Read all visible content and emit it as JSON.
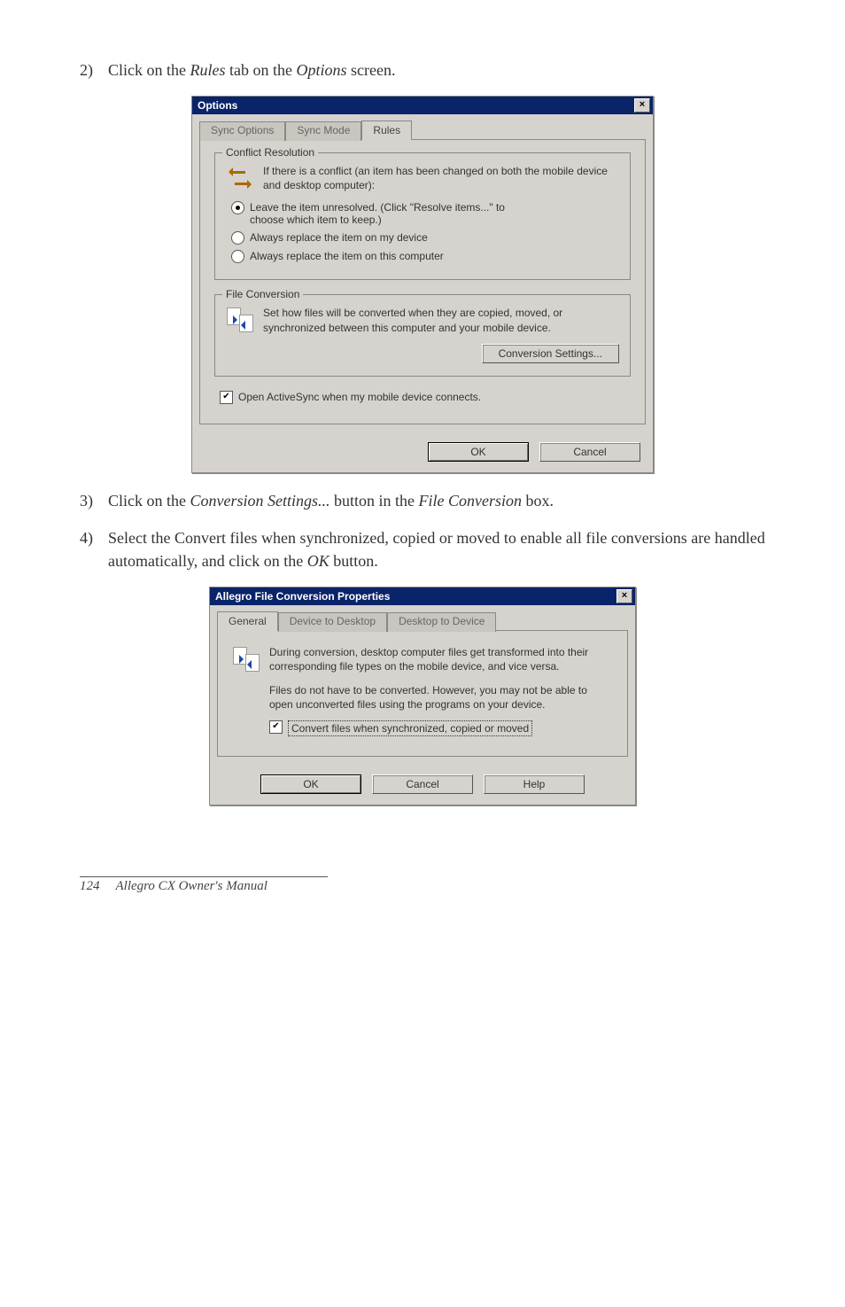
{
  "steps": {
    "s2": {
      "num": "2)",
      "text_a": "Click on the ",
      "em1": "Rules",
      "text_b": " tab on the ",
      "em2": "Options",
      "text_c": " screen."
    },
    "s3": {
      "num": "3)",
      "text_a": "Click on the ",
      "em1": "Conversion Settings...",
      "text_b": " button in the ",
      "em2": "File Conversion",
      "text_c": " box."
    },
    "s4": {
      "num": "4)",
      "text_a": "Select the Convert files when synchronized, copied or moved to enable all file conversions are handled automatically, and click on the ",
      "em1": "OK",
      "text_b": " button."
    }
  },
  "dialog1": {
    "title": "Options",
    "tabs": {
      "sync_options": "Sync Options",
      "sync_mode": "Sync Mode",
      "rules": "Rules"
    },
    "conflict": {
      "legend": "Conflict Resolution",
      "info": "If there is a conflict (an item has been changed on both the mobile device and desktop computer):",
      "r1a": "Leave the item unresolved. (Click \"Resolve items...\" to",
      "r1b": "choose which item to keep.)",
      "r2": "Always replace the item on my device",
      "r3": "Always replace the item on this computer"
    },
    "fileconv": {
      "legend": "File Conversion",
      "info": "Set how files will be converted when they are copied, moved, or synchronized between this computer and your mobile device.",
      "button": "Conversion Settings..."
    },
    "open_as": "Open ActiveSync when my mobile device connects.",
    "ok": "OK",
    "cancel": "Cancel"
  },
  "dialog2": {
    "title": "Allegro File Conversion Properties",
    "tabs": {
      "general": "General",
      "d2d": "Device to Desktop",
      "d2d2": "Desktop to Device"
    },
    "p1": "During conversion, desktop computer files get transformed into their corresponding file types on the mobile device, and vice versa.",
    "p2": "Files do not have to be converted. However, you may not be able to open unconverted files using the programs on your device.",
    "chk": "Convert files when synchronized, copied or moved",
    "ok": "OK",
    "cancel": "Cancel",
    "help": "Help"
  },
  "footer": {
    "page": "124",
    "title": "Allegro CX Owner's Manual"
  }
}
